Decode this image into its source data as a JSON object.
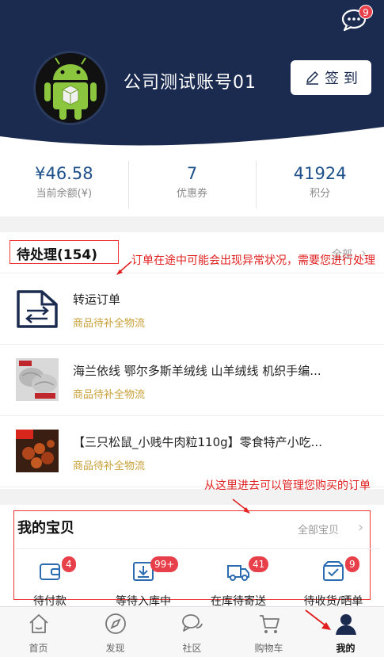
{
  "header": {
    "message_badge": "9",
    "account_name": "公司测试账号01",
    "signin_label": "签 到"
  },
  "stats": [
    {
      "value": "¥46.58",
      "label": "当前余额(¥)"
    },
    {
      "value": "7",
      "label": "优惠券"
    },
    {
      "value": "41924",
      "label": "积分"
    }
  ],
  "pending": {
    "title": "待处理(154)",
    "all_label": "全部",
    "annotation": "订单在途中可能会出现异常状况，需要您进行处理",
    "orders": [
      {
        "title": "转运订单",
        "status": "商品待补全物流",
        "icon": "transfer-document-icon"
      },
      {
        "title": "海兰依线 鄂尔多斯羊绒线 山羊绒线 机织手编...",
        "status": "商品待补全物流",
        "icon": "yarn-product-image"
      },
      {
        "title": "【三只松鼠_小贱牛肉粒110g】零食特产小吃...",
        "status": "商品待补全物流",
        "icon": "beef-snack-product-image"
      }
    ]
  },
  "my_items": {
    "title": "我的宝贝",
    "all_label": "全部宝贝",
    "annotation": "从这里进去可以管理您购买的订单",
    "categories": [
      {
        "label": "待付款",
        "badge": "4",
        "icon": "wallet-icon"
      },
      {
        "label": "等待入库中",
        "badge": "99+",
        "icon": "inbox-download-icon"
      },
      {
        "label": "在库待寄送",
        "badge": "41",
        "icon": "truck-icon"
      },
      {
        "label": "待收货/晒单",
        "badge": "9",
        "icon": "package-check-icon"
      }
    ]
  },
  "nav": [
    {
      "label": "首页",
      "icon": "home-icon"
    },
    {
      "label": "发现",
      "icon": "compass-icon"
    },
    {
      "label": "社区",
      "icon": "chat-bubbles-icon"
    },
    {
      "label": "购物车",
      "icon": "cart-icon"
    },
    {
      "label": "我的",
      "icon": "user-icon",
      "active": true
    }
  ],
  "colors": {
    "header_bg": "#1b2a4f",
    "stat_value": "#1d4f8a",
    "status_gold": "#c9a13a",
    "badge_red": "#e8404a",
    "annotation_red": "#e02020"
  }
}
